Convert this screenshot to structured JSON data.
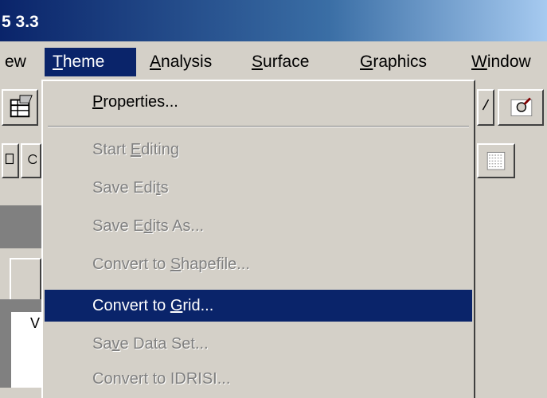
{
  "window": {
    "title": "5 3.3"
  },
  "menubar": {
    "items": [
      {
        "label": "ew"
      },
      {
        "label": "Theme",
        "first": "T",
        "rest": "heme"
      },
      {
        "label": "Analysis",
        "first": "A",
        "rest": "nalysis"
      },
      {
        "label": "Surface",
        "first": "S",
        "rest": "urface"
      },
      {
        "label": "Graphics",
        "first": "G",
        "rest": "raphics"
      },
      {
        "label": "Window",
        "first": "W",
        "rest": "indow"
      }
    ]
  },
  "dropdown": {
    "items": [
      {
        "pre": "",
        "ul": "P",
        "post": "roperties...",
        "enabled": true
      },
      {
        "pre": "Start ",
        "ul": "E",
        "post": "diting",
        "enabled": false
      },
      {
        "pre": "Save Edi",
        "ul": "t",
        "post": "s",
        "enabled": false
      },
      {
        "pre": "Save E",
        "ul": "d",
        "post": "its As...",
        "enabled": false
      },
      {
        "pre": "Convert to ",
        "ul": "S",
        "post": "hapefile...",
        "enabled": false
      },
      {
        "pre": "Convert to ",
        "ul": "G",
        "post": "rid...",
        "enabled": true,
        "highlighted": true
      },
      {
        "pre": "Sa",
        "ul": "v",
        "post": "e Data Set...",
        "enabled": false
      },
      {
        "pre": "Convert to IDRISI...",
        "ul": "",
        "post": "",
        "enabled": false
      }
    ]
  },
  "panel": {
    "partial_text": "V"
  },
  "colors": {
    "face": "#d4d0c8",
    "highlight": "#0a246a",
    "disabled_text": "#808080"
  }
}
